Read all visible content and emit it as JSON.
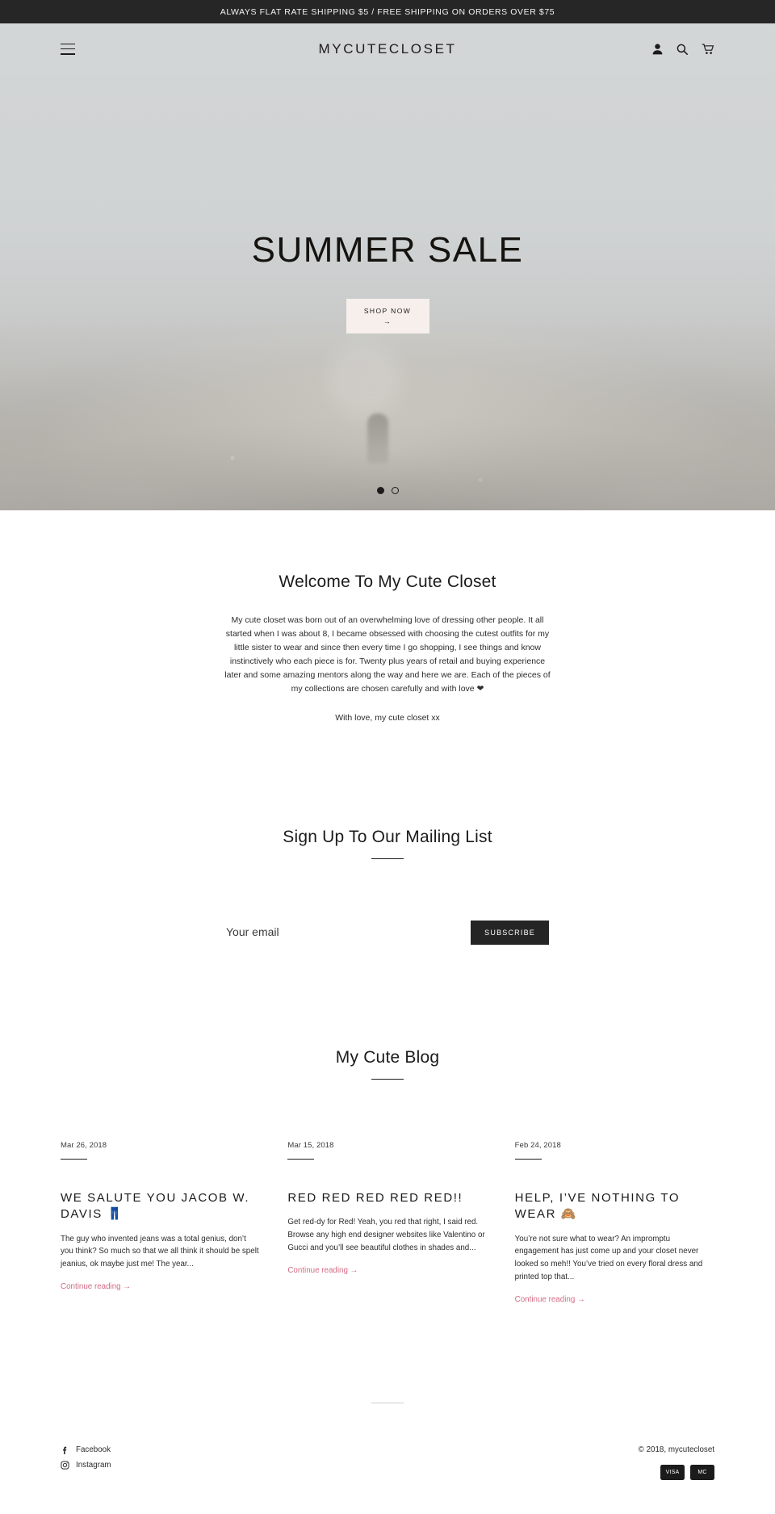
{
  "announcement": {
    "text": "ALWAYS FLAT RATE SHIPPING $5 / FREE SHIPPING ON ORDERS OVER $75"
  },
  "header": {
    "brand": "MYCUTECLOSET",
    "menu_icon": "hamburger-icon",
    "account_icon": "account-icon",
    "search_icon": "search-icon",
    "cart_icon": "cart-icon"
  },
  "hero": {
    "title": "SUMMER SALE",
    "button_label": "SHOP NOW",
    "button_arrow": "→",
    "slide_count": 2,
    "active_slide": 1
  },
  "welcome": {
    "title": "Welcome To My Cute Closet",
    "body": "My cute closet was born out of an overwhelming love of dressing other people.  It all started when I was about 8, I became obsessed with choosing the cutest outfits for my little sister to wear and since then every time I go shopping, I see things and know instinctively who each piece is for.  Twenty plus years of retail and buying experience later and some amazing mentors along the way and here we are.  Each of the pieces of my collections are chosen carefully and with love ❤",
    "signature": "With love, my cute closet xx"
  },
  "newsletter": {
    "title": "Sign Up To Our Mailing List",
    "email_placeholder": "Your email",
    "email_value": "",
    "subscribe_label": "SUBSCRIBE"
  },
  "blog": {
    "title": "My Cute Blog",
    "posts": [
      {
        "date": "Mar 26, 2018",
        "title": "WE SALUTE YOU JACOB W. DAVIS 👖",
        "excerpt": "The guy who invented jeans was a total genius, don’t you think? So much so that we all think it should be spelt jeanius, ok maybe just me! The year...",
        "link_label": "Continue reading →"
      },
      {
        "date": "Mar 15, 2018",
        "title": "RED RED RED RED RED!!",
        "excerpt": "Get red-dy for Red! Yeah, you red that right, I said red. Browse any high end designer websites like Valentino or Gucci and you’ll see beautiful clothes in shades and...",
        "link_label": "Continue reading →"
      },
      {
        "date": "Feb 24, 2018",
        "title": "HELP, I’VE NOTHING TO WEAR 🙈",
        "excerpt": "You’re not sure what to wear? An impromptu engagement has just come up and your closet never looked so meh!! You’ve tried on every floral dress and printed top that...",
        "link_label": "Continue reading →"
      }
    ]
  },
  "footer": {
    "social": [
      {
        "label": "Facebook",
        "icon": "facebook-icon"
      },
      {
        "label": "Instagram",
        "icon": "instagram-icon"
      }
    ],
    "copyright": "© 2018, mycutecloset",
    "payment_icons": [
      {
        "label": "VISA",
        "name": "visa-icon"
      },
      {
        "label": "MC",
        "name": "mastercard-icon"
      }
    ]
  },
  "colors": {
    "announce_bg": "#262626",
    "header_bg": "#d3d6d7",
    "hero_button_bg": "#f6efec",
    "subscribe_bg": "#252525",
    "link_pink": "#d36c84"
  }
}
